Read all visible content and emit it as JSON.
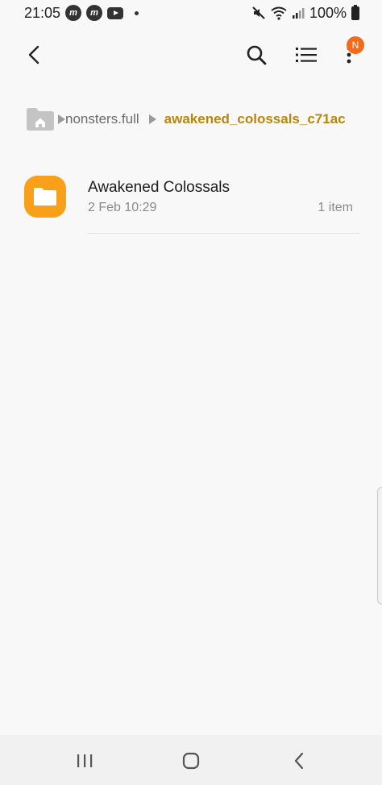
{
  "status_bar": {
    "time": "21:05",
    "notification_icons": [
      "messenger-icon",
      "messenger-icon",
      "youtube-icon",
      "dot-icon"
    ],
    "battery": "100%"
  },
  "toolbar": {
    "back_label": "Back",
    "search_label": "Search",
    "list_view_label": "View",
    "more_label": "More options",
    "badge": "N"
  },
  "breadcrumb": {
    "home_icon": "home-folder-icon",
    "parent": "nonsters.full",
    "current": "awakened_colossals_c71ac"
  },
  "files": [
    {
      "name": "Awakened Colossals",
      "date": "2 Feb 10:29",
      "count": "1 item",
      "icon": "folder-icon"
    }
  ],
  "colors": {
    "accent": "#b7860b",
    "folder": "#f9a01b",
    "badge": "#f26b1d"
  },
  "nav_bar": {
    "recents_label": "Recent apps",
    "home_label": "Home",
    "back_label": "Back"
  }
}
